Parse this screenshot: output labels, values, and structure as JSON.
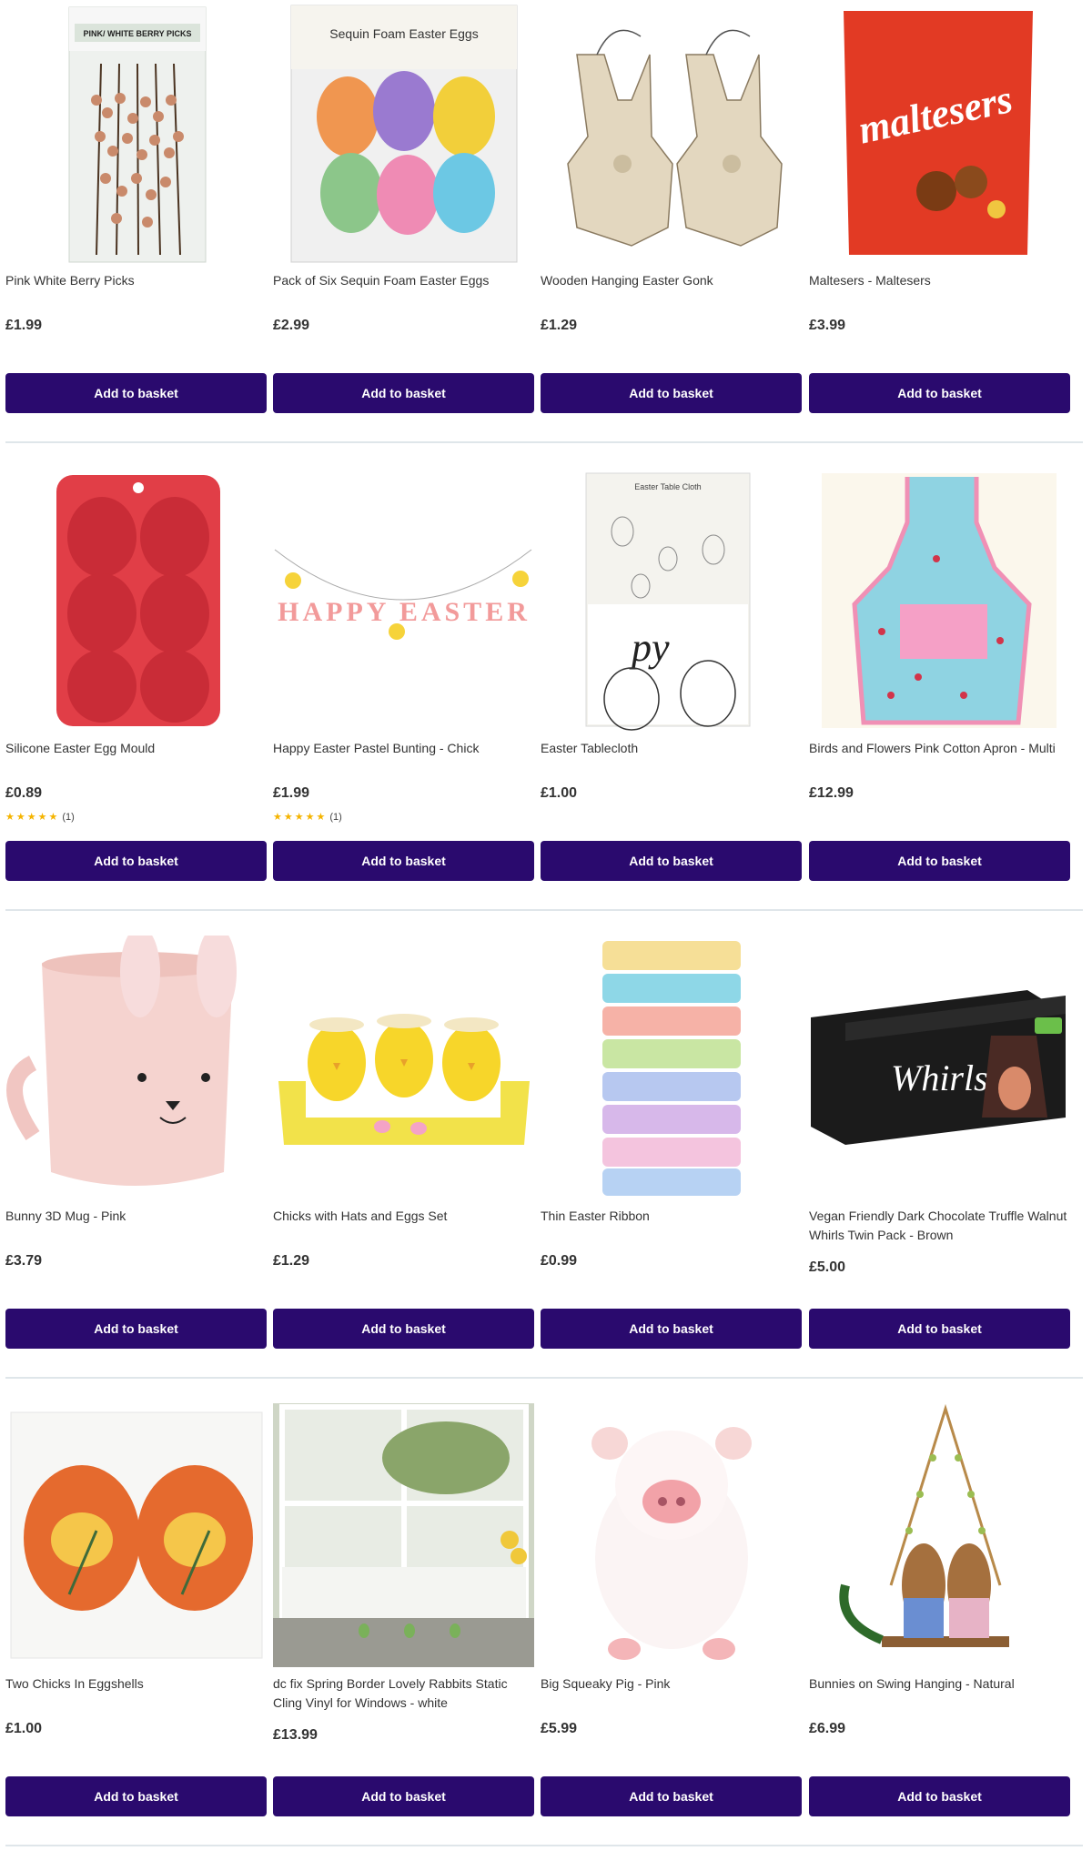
{
  "button_label": "Add to basket",
  "colors": {
    "button": "#2a0a6e",
    "star": "#f5b400"
  },
  "rows": [
    [
      {
        "title": "Pink White Berry Picks",
        "price": "£1.99",
        "image": "berry-picks-image",
        "package_text": "PINK/ WHITE BERRY PICKS"
      },
      {
        "title": "Pack of Six Sequin Foam Easter Eggs",
        "price": "£2.99",
        "image": "sequin-eggs-image",
        "package_text": "Sequin Foam Easter Eggs"
      },
      {
        "title": "Wooden Hanging Easter Gonk",
        "price": "£1.29",
        "image": "wooden-gonk-image"
      },
      {
        "title": "Maltesers - Maltesers",
        "price": "£3.99",
        "image": "maltesers-image",
        "package_text": "maltesers"
      }
    ],
    [
      {
        "title": "Silicone Easter Egg Mould",
        "price": "£0.89",
        "image": "egg-mould-image",
        "rating": "(1)"
      },
      {
        "title": "Happy Easter Pastel Bunting - Chick",
        "price": "£1.99",
        "image": "bunting-image",
        "rating": "(1)",
        "package_text": "HAPPY EASTER"
      },
      {
        "title": "Easter Tablecloth",
        "price": "£1.00",
        "image": "tablecloth-image",
        "package_text": "Easter Table Cloth"
      },
      {
        "title": "Birds and Flowers Pink Cotton Apron - Multi",
        "price": "£12.99",
        "image": "apron-image"
      }
    ],
    [
      {
        "title": "Bunny 3D Mug - Pink",
        "price": "£3.79",
        "image": "bunny-mug-image"
      },
      {
        "title": "Chicks with Hats and Eggs Set",
        "price": "£1.29",
        "image": "chicks-image"
      },
      {
        "title": "Thin Easter Ribbon",
        "price": "£0.99",
        "image": "ribbon-image"
      },
      {
        "title": "Vegan Friendly Dark Chocolate Truffle Walnut Whirls Twin Pack - Brown",
        "price": "£5.00",
        "image": "whirls-image",
        "package_text": "Whirls"
      }
    ],
    [
      {
        "title": "Two Chicks In Eggshells",
        "price": "£1.00",
        "image": "eggshell-chicks-image"
      },
      {
        "title": "dc fix Spring Border Lovely Rabbits Static Cling Vinyl for Windows - white",
        "price": "£13.99",
        "image": "window-cling-image"
      },
      {
        "title": "Big Squeaky Pig - Pink",
        "price": "£5.99",
        "image": "squeaky-pig-image"
      },
      {
        "title": "Bunnies on Swing Hanging - Natural",
        "price": "£6.99",
        "image": "bunnies-swing-image"
      }
    ]
  ]
}
